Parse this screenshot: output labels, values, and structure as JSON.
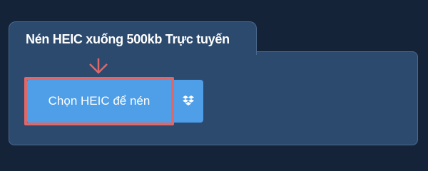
{
  "tab": {
    "title": "Nén HEIC xuống 500kb Trực tuyến"
  },
  "upload": {
    "choose_label": "Chọn HEIC để nén",
    "dropbox_icon": "dropbox-icon"
  },
  "colors": {
    "page_background": "#152338",
    "panel_background": "#2c4a6e",
    "button_blue": "#4e9ee8",
    "highlight_red": "#e06767"
  }
}
